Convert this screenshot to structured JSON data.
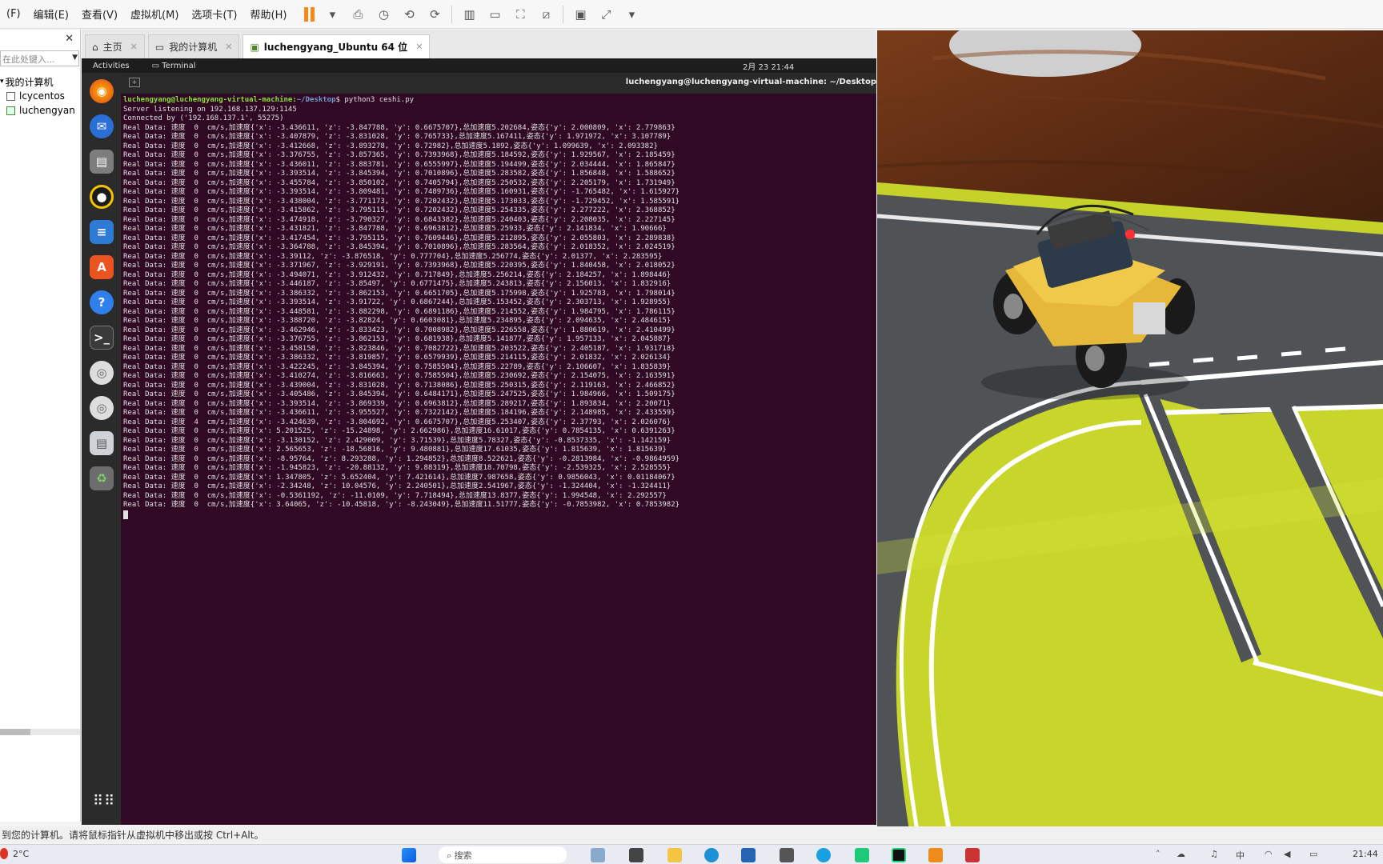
{
  "menu": {
    "items": [
      "(F)",
      "编辑(E)",
      "查看(V)",
      "虚拟机(M)",
      "选项卡(T)",
      "帮助(H)"
    ]
  },
  "library": {
    "close": "✕",
    "search_placeholder": "在此处键入...",
    "tree": [
      "我的计算机",
      "lcycentos",
      "luchengyan"
    ]
  },
  "tabs": [
    {
      "label": "主页"
    },
    {
      "label": "我的计算机"
    },
    {
      "label": "luchengyang_Ubuntu 64 位"
    }
  ],
  "ubuntu": {
    "activities": "Activities",
    "app": "Terminal",
    "clock": "2月 23 21:44",
    "terminal_title": "luchengyang@luchengyang-virtual-machine: ~/Desktop"
  },
  "terminal": {
    "prompt_user": "luchengyang@luchengyang-virtual-machine:",
    "prompt_path": "~/Desktop",
    "command": "$ python3 ceshi.py",
    "lines": [
      "Server listening on 192.168.137.129:1145",
      "Connected by ('192.168.137.1', 55275)",
      "Real Data: 速度  0  cm/s,加速度{'x': -3.436611, 'z': -3.847788, 'y': 0.6675707},总加速度5.202684,姿态{'y': 2.000809, 'x': 2.779863}",
      "Real Data: 速度  0  cm/s,加速度{'x': -3.407879, 'z': -3.831028, 'y': 0.765733},总加速度5.167411,姿态{'y': 1.971972, 'x': 3.107789}",
      "Real Data: 速度  0  cm/s,加速度{'x': -3.412668, 'z': -3.893278, 'y': 0.72982},总加速度5.1892,姿态{'y': 1.099639, 'x': 2.093382}",
      "Real Data: 速度  0  cm/s,加速度{'x': -3.376755, 'z': -3.857365, 'y': 0.7393968},总加速度5.184592,姿态{'y': 1.929567, 'x': 2.185459}",
      "Real Data: 速度  0  cm/s,加速度{'x': -3.436011, 'z': -3.883781, 'y': 0.6555997},总加速度5.194499,姿态{'y': 2.034444, 'x': 1.865847}",
      "Real Data: 速度  0  cm/s,加速度{'x': -3.393514, 'z': -3.845394, 'y': 0.7010896},总加速度5.283582,姿态{'y': 1.856848, 'x': 1.588652}",
      "Real Data: 速度  0  cm/s,加速度{'x': -3.455784, 'z': -3.850102, 'y': 0.7405794},总加速度5.250532,姿态{'y': 2.205179, 'x': 1.731949}",
      "Real Data: 速度  0  cm/s,加速度{'x': -3.393514, 'z': -3.809481, 'y': 0.7489736},总加速度5.160931,姿态{'y': -1.765482, 'x': 1.615927}",
      "Real Data: 速度  0  cm/s,加速度{'x': -3.438004, 'z': -3.771173, 'y': 0.7202432},总加速度5.173033,姿态{'y': -1.729452, 'x': 1.585591}",
      "Real Data: 速度  0  cm/s,加速度{'x': -3.415862, 'z': -3.795115, 'y': 0.7202432},总加速度5.254335,姿态{'y': 2.277222, 'x': 2.368852}",
      "Real Data: 速度  0  cm/s,加速度{'x': -3.474918, 'z': -3.790327, 'y': 0.6843382},总加速度5.240403,姿态{'y': 2.208035, 'x': 2.227145}",
      "Real Data: 速度  0  cm/s,加速度{'x': -3.431821, 'z': -3.847788, 'y': 0.6963812},总加速度5.25933,姿态{'y': 2.141834, 'x': 1.90666}",
      "Real Data: 速度  0  cm/s,加速度{'x': -3.417454, 'z': -3.795115, 'y': 0.7609446},总加速度5.212895,姿态{'y': 2.055803, 'x': 2.289838}",
      "Real Data: 速度  0  cm/s,加速度{'x': -3.364788, 'z': -3.845394, 'y': 0.7010896},总加速度5.283564,姿态{'y': 2.018352, 'x': 2.024519}",
      "Real Data: 速度  0  cm/s,加速度{'x': -3.39112, 'z': -3.876518, 'y': 0.777704},总加速度5.256774,姿态{'y': 2.01377, 'x': 2.283595}",
      "Real Data: 速度  0  cm/s,加速度{'x': -3.371967, 'z': -3.929191, 'y': 0.7393968},总加速度5.220395,姿态{'y': 1.840458, 'x': 2.018052}",
      "Real Data: 速度  0  cm/s,加速度{'x': -3.494071, 'z': -3.912432, 'y': 0.717849},总加速度5.256214,姿态{'y': 2.184257, 'x': 1.898446}",
      "Real Data: 速度  0  cm/s,加速度{'x': -3.446187, 'z': -3.85497, 'y': 0.6771475},总加速度5.243813,姿态{'y': 2.156013, 'x': 1.832916}",
      "Real Data: 速度  0  cm/s,加速度{'x': -3.386332, 'z': -3.862153, 'y': 0.6651705},总加速度5.175998,姿态{'y': 1.925783, 'x': 1.798014}",
      "Real Data: 速度  0  cm/s,加速度{'x': -3.393514, 'z': -3.91722, 'y': 0.6867244},总加速度5.153452,姿态{'y': 2.303713, 'x': 1.928955}",
      "Real Data: 速度  0  cm/s,加速度{'x': -3.448581, 'z': -3.882298, 'y': 0.6891186},总加速度5.214552,姿态{'y': 1.984795, 'x': 1.786115}",
      "Real Data: 速度  0  cm/s,加速度{'x': -3.388720, 'z': -3.82824, 'y': 0.6603081},总加速度5.234895,姿态{'y': 2.094635, 'x': 2.484615}",
      "Real Data: 速度  0  cm/s,加速度{'x': -3.462946, 'z': -3.833423, 'y': 0.7008982},总加速度5.226558,姿态{'y': 1.880619, 'x': 2.410499}",
      "Real Data: 速度  0  cm/s,加速度{'x': -3.376755, 'z': -3.862153, 'y': 0.681938},总加速度5.141877,姿态{'y': 1.957133, 'x': 2.045887}",
      "Real Data: 速度  0  cm/s,加速度{'x': -3.458158, 'z': -3.823846, 'y': 0.7082722},总加速度5.203522,姿态{'y': 2.405187, 'x': 1.931718}",
      "Real Data: 速度  0  cm/s,加速度{'x': -3.386332, 'z': -3.819857, 'y': 0.6579939},总加速度5.214115,姿态{'y': 2.01832, 'x': 2.026134}",
      "Real Data: 速度  0  cm/s,加速度{'x': -3.422245, 'z': -3.845394, 'y': 0.7585504},总加速度5.22789,姿态{'y': 2.106607, 'x': 1.835839}",
      "Real Data: 速度  0  cm/s,加速度{'x': -3.410274, 'z': -3.816663, 'y': 0.7585504},总加速度5.230692,姿态{'y': 2.154075, 'x': 2.163591}",
      "Real Data: 速度  0  cm/s,加速度{'x': -3.439004, 'z': -3.831028, 'y': 0.7138086},总加速度5.250315,姿态{'y': 2.119163, 'x': 2.466852}",
      "Real Data: 速度  0  cm/s,加速度{'x': -3.405486, 'z': -3.845394, 'y': 0.6484171},总加速度5.247525,姿态{'y': 1.984966, 'x': 1.509175}",
      "Real Data: 速度  0  cm/s,加速度{'x': -3.393514, 'z': -3.869339, 'y': 0.6963812},总加速度5.289217,姿态{'y': 1.893834, 'x': 2.20071}",
      "Real Data: 速度  0  cm/s,加速度{'x': -3.436611, 'z': -3.955527, 'y': 0.7322142},总加速度5.184196,姿态{'y': 2.148985, 'x': 2.433559}",
      "Real Data: 速度  4  cm/s,加速度{'x': -3.424639, 'z': -3.804692, 'y': 0.6675707},总加速度5.253407,姿态{'y': 2.37793, 'x': 2.026076}",
      "Real Data: 速度  0  cm/s,加速度{'x': 5.201525, 'z': -15.24898, 'y': 2.662986},总加速度16.61017,姿态{'y': 0.7854135, 'x': 0.6391263}",
      "Real Data: 速度  0  cm/s,加速度{'x': -3.130152, 'z': 2.429009, 'y': 3.71539},总加速度5.78327,姿态{'y': -0.8537335, 'x': -1.142159}",
      "Real Data: 速度  0  cm/s,加速度{'x': 2.565653, 'z': -18.56816, 'y': 9.480881},总加速度17.61035,姿态{'y': 1.815639, 'x': 1.815639}",
      "Real Data: 速度  0  cm/s,加速度{'x': -8.95764, 'z': 8.293288, 'y': 1.294852},总加速度8.522621,姿态{'y': -0.2813984, 'x': -0.9864959}",
      "Real Data: 速度  0  cm/s,加速度{'x': -1.945823, 'z': -20.88132, 'y': 9.88319},总加速度18.70798,姿态{'y': -2.539325, 'x': 2.528555}",
      "Real Data: 速度  0  cm/s,加速度{'x': 1.347805, 'z': 5.652404, 'y': 7.421614},总加速度7.987658,姿态{'y': 0.9856043, 'x': 0.01184067}",
      "Real Data: 速度  0  cm/s,加速度{'x': -2.34248, 'z': 10.04576, 'y': 2.240501},总加速度2.541967,姿态{'y': -1.324404, 'x': -1.324411}",
      "Real Data: 速度  0  cm/s,加速度{'x': -0.5361192, 'z': -11.0109, 'y': 7.718494},总加速度13.8377,姿态{'y': 1.994548, 'x': 2.292557}",
      "Real Data: 速度  0  cm/s,加速度{'x': 3.64065, 'z': -10.45818, 'y': -8.243049},总加速度11.51777,姿态{'y': -0.7853982, 'x': 0.7853982}"
    ]
  },
  "statusbar": {
    "text": "到您的计算机。请将鼠标指针从虚拟机中移出或按 Ctrl+Alt。"
  },
  "taskbar": {
    "weather": "2°C",
    "search_label": "搜索",
    "time": "21:44"
  }
}
